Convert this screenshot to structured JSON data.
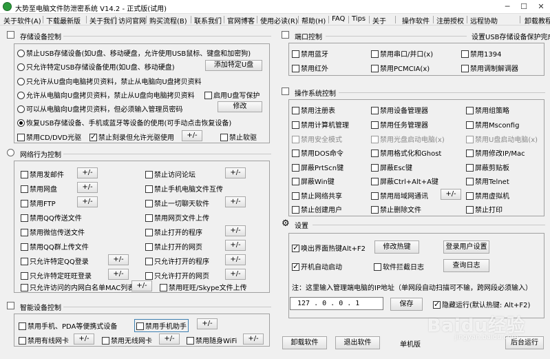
{
  "window": {
    "title": "大势至电脑文件防泄密系统 V14.2 - 正式版(试用)",
    "min": "─",
    "max": "☐",
    "close": "✕"
  },
  "menu": [
    "关于软件(A)",
    "下载最新版",
    "关于我们",
    "访问官网",
    "购买流程(B)",
    "联系我们",
    "官网博客",
    "使用必读(R)",
    "帮助(H)",
    "FAQ",
    "Tips",
    "关于",
    "操作软件",
    "注册授权",
    "远程协助",
    "卸载教程"
  ],
  "storage": {
    "title": "存储设备控制",
    "radios": [
      "禁止USB存储设备(如U盘、移动硬盘，允许使用USB鼠标、键盘和加密狗)",
      "只允许特定USB存储设备使用(如U盘、移动硬盘)",
      "只允许从U盘向电脑拷贝资料，禁止从电脑向U盘拷贝资料",
      "允许从电脑向U盘拷贝资料，禁止从U盘向电脑拷贝资料",
      "可以从电脑向U盘拷贝资料，但必须输入管理员密码",
      "恢复USB存储设备、手机或蓝牙等设备的使用(可手动点击恢复设备)"
    ],
    "add_udisk": "添加特定U盘",
    "udisk_protect": "启用U盘写保护",
    "modify": "修改",
    "cd_disable": "禁用CD/DVD光驱",
    "burn_disable": "禁止刻录但允许光驱使用",
    "floppy_disable": "禁止软驱",
    "pm": "+/-"
  },
  "network": {
    "title": "网络行为控制",
    "left": [
      "禁用发邮件",
      "禁用网盘",
      "禁用FTP",
      "禁用QQ传送文件",
      "禁用微信传送文件",
      "禁用QQ群上传文件",
      "只允许特定QQ登录",
      "只允许特定旺旺登录"
    ],
    "right": [
      "禁止访问论坛",
      "禁止手机电脑文件互传",
      "禁止一切聊天软件",
      "禁用网页文件上传",
      "禁止打开的程序",
      "禁止打开的网页",
      "只允许打开的程序",
      "只允许打开的网页"
    ],
    "mac_list": "只允许访问的内网白名单MAC列表",
    "wangwang": "禁用旺旺/Skype文件上传"
  },
  "smart": {
    "title": "智能设备控制",
    "phone_pda": "禁用手机、PDA等便携式设备",
    "phone_helper": "禁用手机助手",
    "wired": "禁用有线网卡",
    "wireless": "禁用无线网卡",
    "wifi": "禁用随身WiFi"
  },
  "port": {
    "title": "端口控制",
    "status": "设置USB存储设备保护完成",
    "items": [
      "禁用蓝牙",
      "禁用串口/并口(x)",
      "禁用1394",
      "禁用红外",
      "禁用PCMCIA(x)",
      "禁用调制解调器"
    ]
  },
  "os": {
    "title": "操作系统控制",
    "col1": [
      "禁用注册表",
      "禁用计算机管理",
      "禁用安全模式",
      "禁用DOS命令",
      "屏蔽PrtScn键",
      "屏蔽Win键",
      "禁止网络共享",
      "禁止创建用户"
    ],
    "col2": [
      "禁用设备管理器",
      "禁用任务管理器",
      "禁用光盘启动电脑(x)",
      "禁用格式化和Ghost",
      "屏蔽Esc键",
      "屏蔽Ctrl+Alt+A键",
      "禁用局域网通讯",
      "禁止删除文件"
    ],
    "col3": [
      "禁用组策略",
      "禁用Msconfig",
      "禁用U盘启动电脑(x)",
      "禁用修改IP/Mac",
      "屏蔽剪贴板",
      "禁用Telnet",
      "禁用虚拟机",
      "禁止打印"
    ]
  },
  "settings": {
    "title": "设置",
    "hotkey_wake": "唤出界面热键Alt+F2",
    "modify_hotkey": "修改热键",
    "login_user": "登录用户设置",
    "autostart": "开机自动启动",
    "intercept_log": "软件拦截日志",
    "query_log": "查询日志",
    "note": "注：这里输入管理端电脑的IP地址（单网段自动扫描可不输，跨网段必须输入）",
    "ip": "127 . 0 . 0 . 1",
    "save": "保存",
    "hide_run": "隐藏运行(默认热键: Alt+F2)"
  },
  "bottom": {
    "uninstall": "卸载软件",
    "exit": "退出软件",
    "version": "单机版",
    "background": "后台运行"
  },
  "watermark": "Baidu经验",
  "watermark_url": "jingyan.baidu.com"
}
